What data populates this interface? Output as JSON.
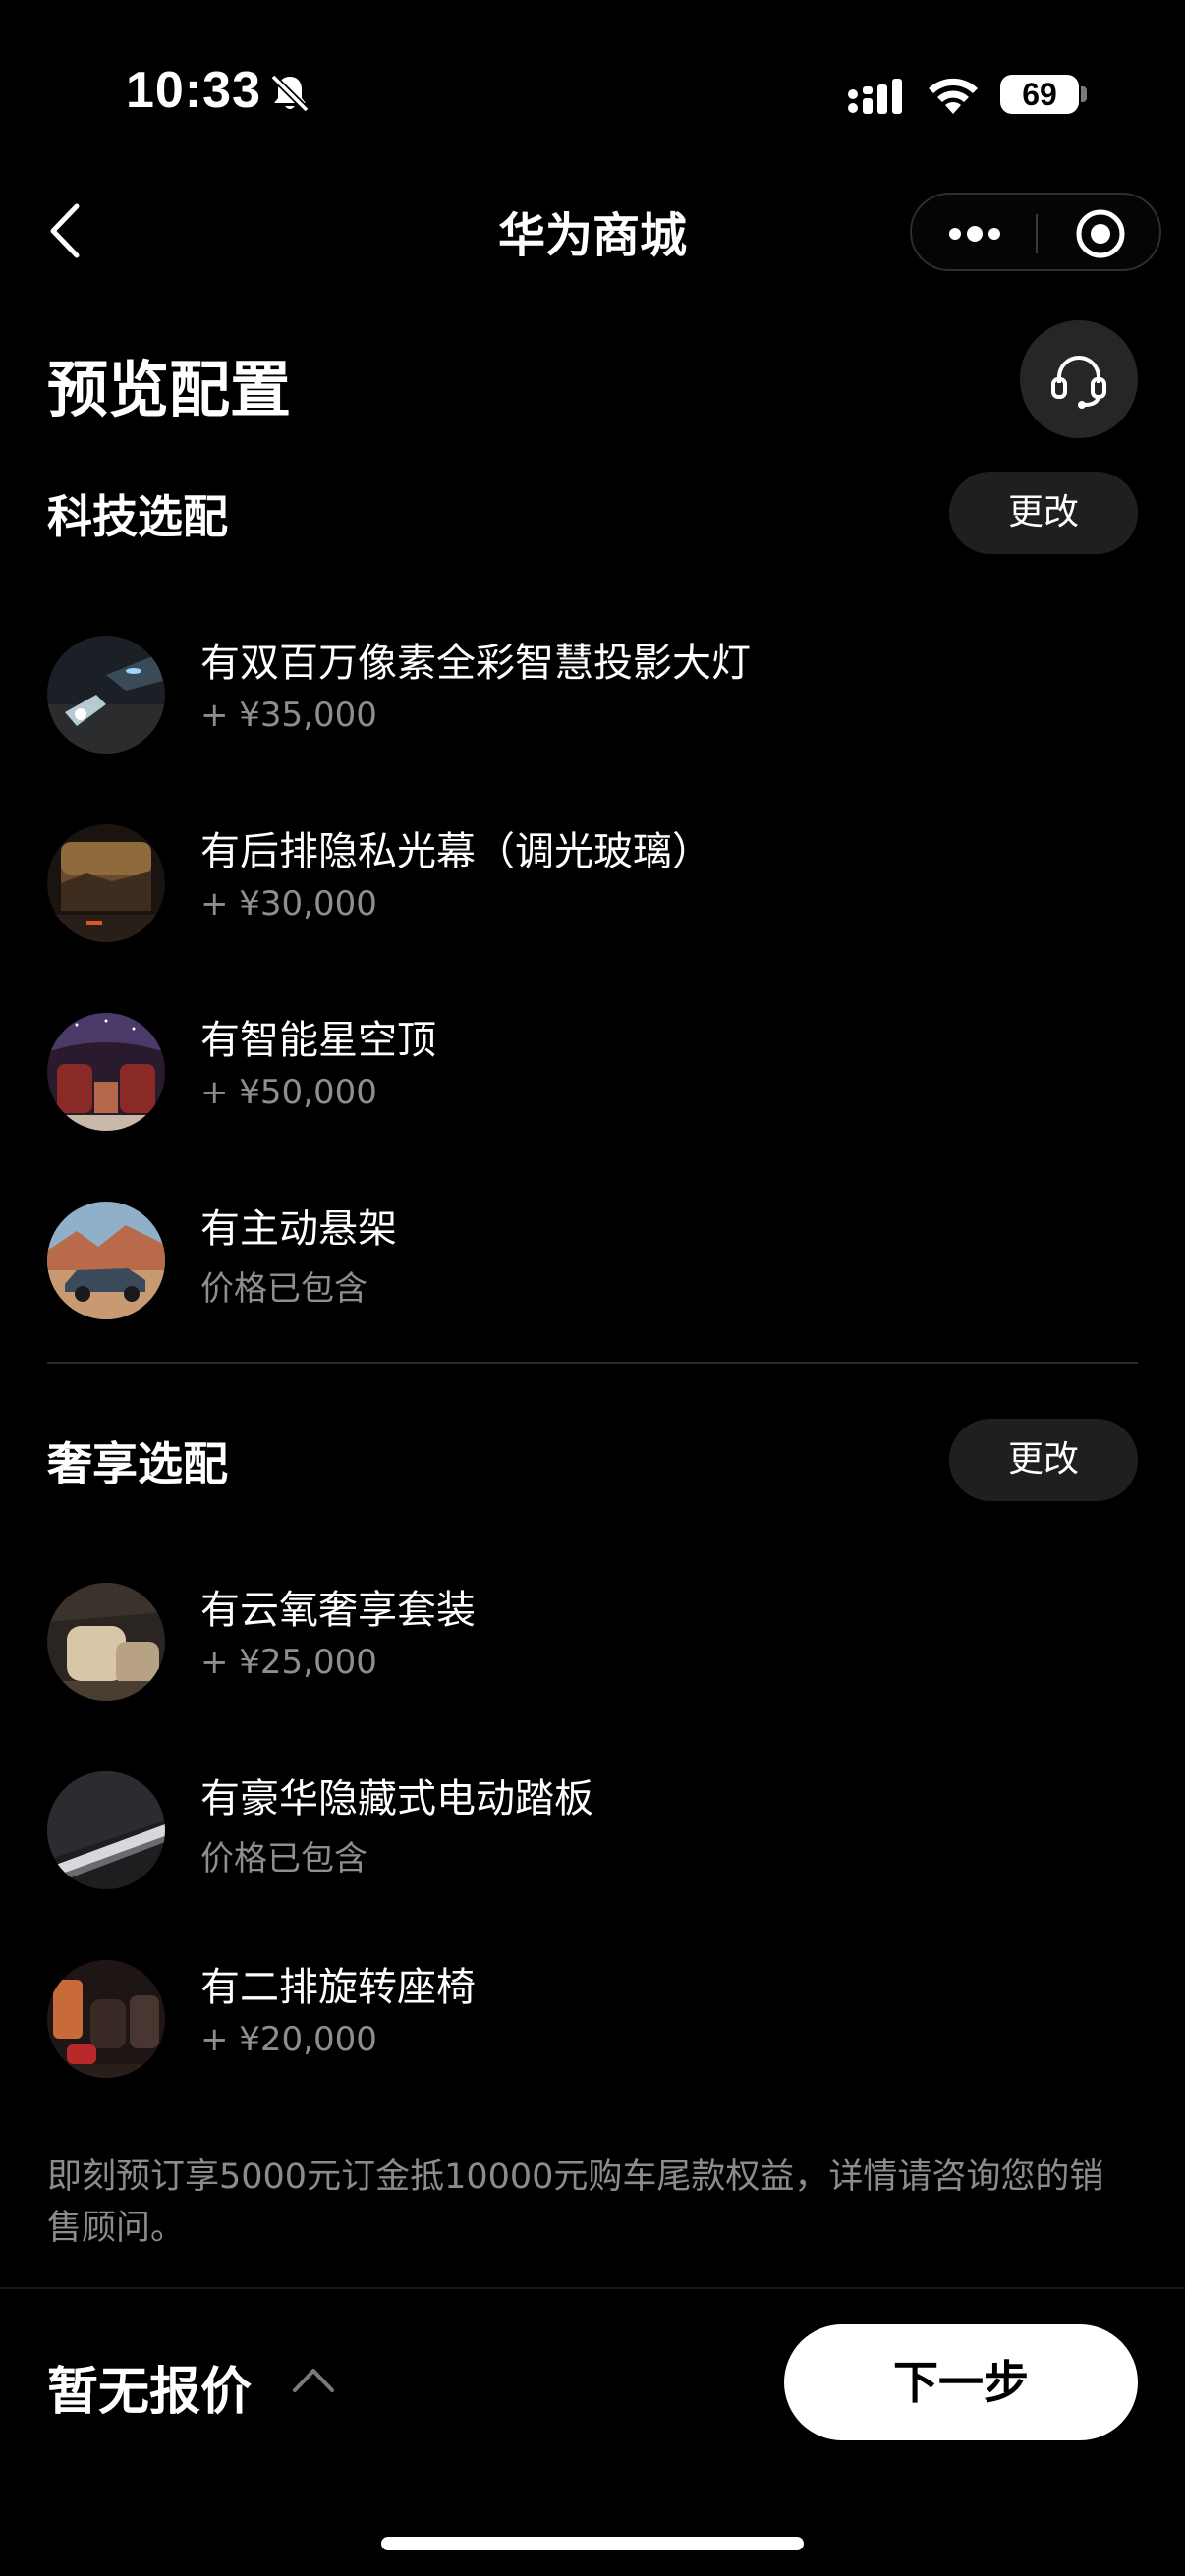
{
  "status_bar": {
    "time": "10:33",
    "battery": "69"
  },
  "nav": {
    "title": "华为商城"
  },
  "page": {
    "title": "预览配置"
  },
  "sections": [
    {
      "title": "科技选配",
      "change_label": "更改",
      "items": [
        {
          "name": "有双百万像素全彩智慧投影大灯",
          "price": "+ ¥35,000",
          "thumb": "headlight-projection"
        },
        {
          "name": "有后排隐私光幕（调光玻璃）",
          "price": "+ ¥30,000",
          "thumb": "rear-window-sunset"
        },
        {
          "name": "有智能星空顶",
          "price": "+ ¥50,000",
          "thumb": "starry-roof-cabin"
        },
        {
          "name": "有主动悬架",
          "price": "价格已包含",
          "thumb": "suv-desert"
        }
      ]
    },
    {
      "title": "奢享选配",
      "change_label": "更改",
      "items": [
        {
          "name": "有云氧奢享套装",
          "price": "+ ¥25,000",
          "thumb": "luxury-seat"
        },
        {
          "name": "有豪华隐藏式电动踏板",
          "price": "价格已包含",
          "thumb": "running-board"
        },
        {
          "name": "有二排旋转座椅",
          "price": "+ ¥20,000",
          "thumb": "swivel-seat"
        }
      ]
    }
  ],
  "notice": "即刻预订享5000元订金抵10000元购车尾款权益，详情请咨询您的销售顾问。",
  "bottom_bar": {
    "quote_label": "暂无报价",
    "next_label": "下一步"
  },
  "colors": {
    "background": "#000000",
    "secondary_text": "#8e8e8e",
    "button_bg": "#1f1f1f",
    "primary_button": "#ffffff"
  }
}
